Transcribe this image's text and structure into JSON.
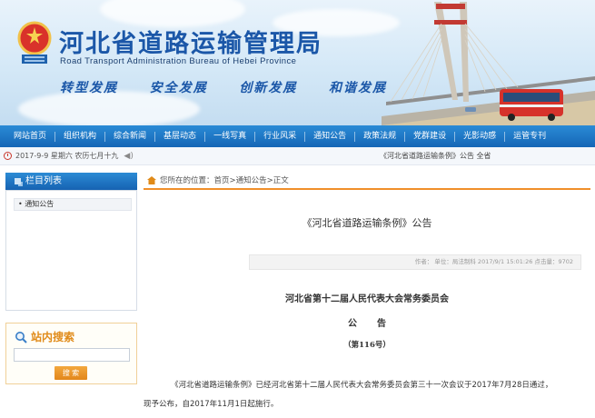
{
  "header": {
    "title_cn": "河北省道路运输管理局",
    "title_en": "Road Transport Administration Bureau of Hebei Province",
    "slogans": [
      "转型发展",
      "安全发展",
      "创新发展",
      "和谐发展"
    ],
    "brand_color": "#1b57a8"
  },
  "nav": {
    "items": [
      "网站首页",
      "组织机构",
      "综合新闻",
      "基层动态",
      "一线写真",
      "行业风采",
      "通知公告",
      "政策法规",
      "党群建设",
      "光影动感",
      "运管专刊"
    ],
    "bg_color": "#1566b6"
  },
  "info_bar": {
    "date": "2017-9-9 星期六 农历七月十九",
    "notice": "《河北省道路运输条例》公告  全省"
  },
  "sidebar": {
    "title": "栏目列表",
    "items": [
      "通知公告"
    ]
  },
  "search": {
    "title": "站内搜索",
    "placeholder": "",
    "button": "搜 索",
    "accent": "#e08a18"
  },
  "breadcrumb": {
    "prefix": "您所在的位置：",
    "path": [
      "首页",
      "通知公告",
      "正文"
    ],
    "separator": " > "
  },
  "article": {
    "title": "《河北省道路运输条例》公告",
    "meta": "作者：  单位：局法制科  2017/9/1 15:01:26  点击量：9702",
    "org": "河北省第十二届人民代表大会常务委员会",
    "notice_word": "公告",
    "number": "（第116号）",
    "body_line1": "《河北省道路运输条例》已经河北省第十二届人民代表大会常务委员会第三十一次会议于2017年7月28日通过，",
    "body_line2": "现予公布，自2017年11月1日起施行。"
  }
}
